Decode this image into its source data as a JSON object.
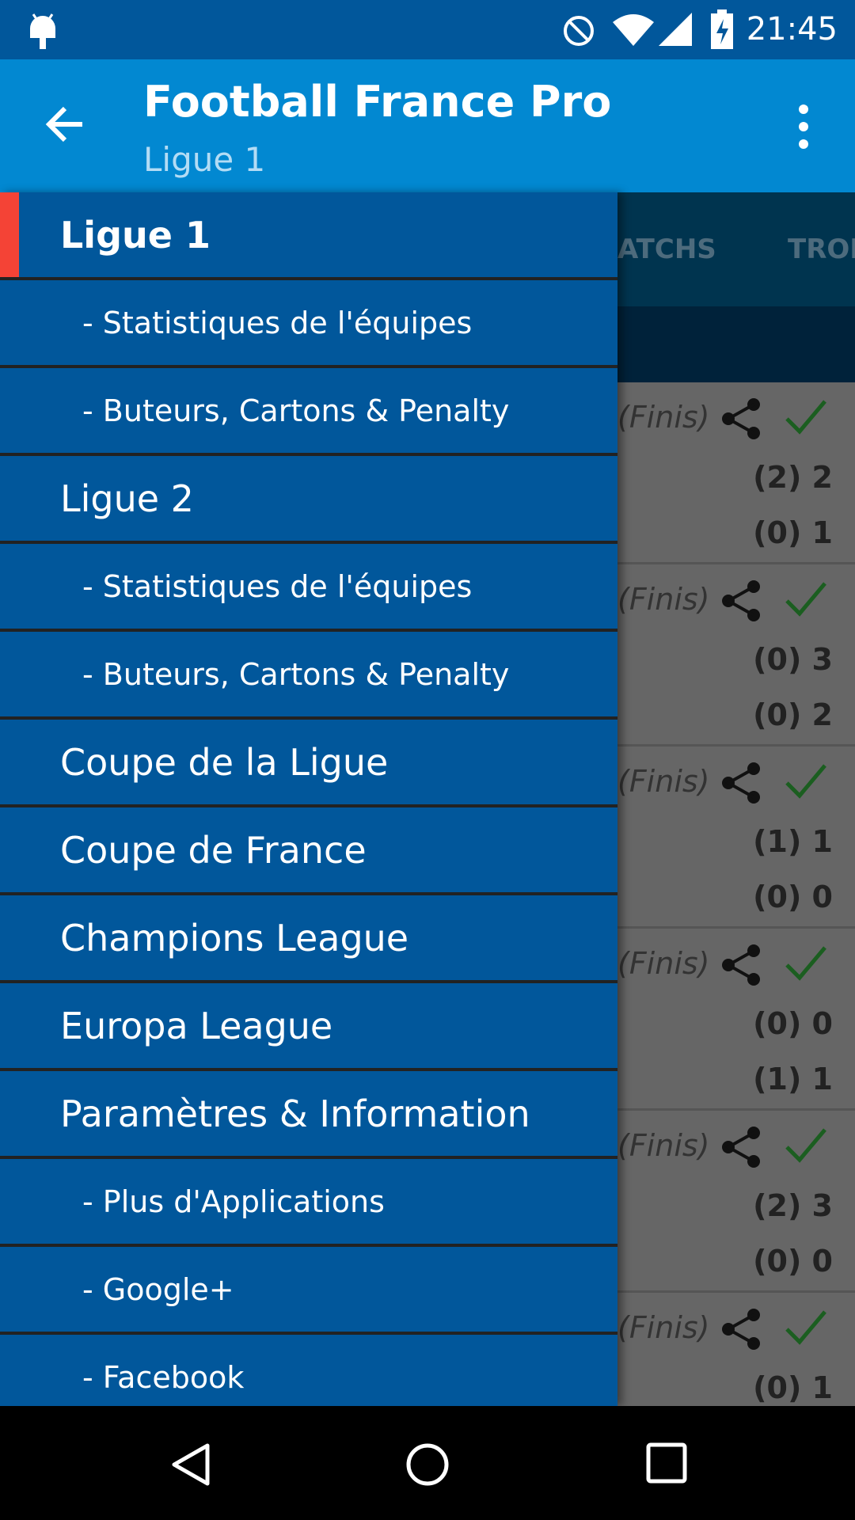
{
  "status_bar": {
    "time": "21:45",
    "icons": [
      "android-debug-icon",
      "do-not-disturb-icon",
      "wifi-icon",
      "signal-icon",
      "battery-charging-icon"
    ]
  },
  "app_bar": {
    "title": "Football France Pro",
    "subtitle": "Ligue 1"
  },
  "tabs": [
    "MATCHS",
    "TROPHÉES"
  ],
  "tabs_visible": [
    "ATCHS",
    "TROF"
  ],
  "drawer": {
    "items": [
      {
        "label": "Ligue 1",
        "type": "main",
        "active": true
      },
      {
        "label": "- Statistiques de l'équipes",
        "type": "sub"
      },
      {
        "label": "- Buteurs, Cartons & Penalty",
        "type": "sub"
      },
      {
        "label": "Ligue 2",
        "type": "main"
      },
      {
        "label": "- Statistiques de l'équipes",
        "type": "sub"
      },
      {
        "label": "- Buteurs, Cartons & Penalty",
        "type": "sub"
      },
      {
        "label": "Coupe de la Ligue",
        "type": "main"
      },
      {
        "label": "Coupe de France",
        "type": "main"
      },
      {
        "label": "Champions League",
        "type": "main"
      },
      {
        "label": "Europa League",
        "type": "main"
      },
      {
        "label": "Paramètres & Information",
        "type": "main"
      },
      {
        "label": "- Plus d'Applications",
        "type": "sub"
      },
      {
        "label": "- Google+",
        "type": "sub"
      },
      {
        "label": "- Facebook",
        "type": "sub"
      }
    ],
    "accent": "#f44336"
  },
  "matches": [
    {
      "status": "(Finis)",
      "home": "(2)  2",
      "away": "(0)  1"
    },
    {
      "status": "(Finis)",
      "home": "(0)  3",
      "away": "(0)  2"
    },
    {
      "status": "(Finis)",
      "home": "(1)  1",
      "away": "(0)  0"
    },
    {
      "status": "(Finis)",
      "home": "(0)  0",
      "away": "(1)  1"
    },
    {
      "status": "(Finis)",
      "home": "(2)  3",
      "away": "(0)  0"
    },
    {
      "status": "(Finis)",
      "home": "(0)  1",
      "away": ""
    }
  ],
  "colors": {
    "status_bar": "#01579b",
    "app_bar": "#0288d1",
    "drawer": "#01579b",
    "check": "#1b5e20"
  }
}
